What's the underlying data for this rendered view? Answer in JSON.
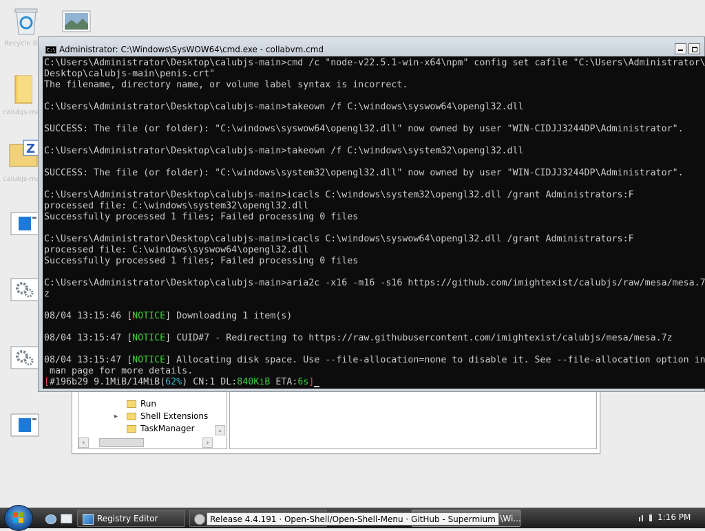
{
  "desktop": {
    "icons": [
      {
        "name": "recycle-bin-icon",
        "label": "Recycle Bin"
      },
      {
        "name": "image-file-icon",
        "label": ""
      },
      {
        "name": "folder-icon",
        "label": "calubjs-main"
      },
      {
        "name": "zip-archive-icon",
        "label": "calubjs-main"
      },
      {
        "name": "window-shortcut-icon",
        "label": ""
      },
      {
        "name": "settings-shortcut-icon",
        "label": ""
      },
      {
        "name": "settings-shortcut-icon-2",
        "label": ""
      },
      {
        "name": "window-shortcut-icon-2",
        "label": ""
      }
    ]
  },
  "registry_editor": {
    "tree_items": [
      "Run",
      "Shell Extensions",
      "TaskManager"
    ]
  },
  "cmd": {
    "title": "Administrator: C:\\Windows\\SysWOW64\\cmd.exe - collabvm.cmd",
    "lines": [
      "C:\\Users\\Administrator\\Desktop\\calubjs-main>cmd /c \"node-v22.5.1-win-x64\\npm\" config set cafile \"C:\\Users\\Administrator\\",
      "Desktop\\calubjs-main\\penis.crt\"",
      "The filename, directory name, or volume label syntax is incorrect.",
      "",
      "C:\\Users\\Administrator\\Desktop\\calubjs-main>takeown /f C:\\windows\\syswow64\\opengl32.dll",
      "",
      "SUCCESS: The file (or folder): \"C:\\windows\\syswow64\\opengl32.dll\" now owned by user \"WIN-CIDJJ3244DP\\Administrator\".",
      "",
      "C:\\Users\\Administrator\\Desktop\\calubjs-main>takeown /f C:\\windows\\system32\\opengl32.dll",
      "",
      "SUCCESS: The file (or folder): \"C:\\windows\\system32\\opengl32.dll\" now owned by user \"WIN-CIDJJ3244DP\\Administrator\".",
      "",
      "C:\\Users\\Administrator\\Desktop\\calubjs-main>icacls C:\\windows\\system32\\opengl32.dll /grant Administrators:F",
      "processed file: C:\\windows\\system32\\opengl32.dll",
      "Successfully processed 1 files; Failed processing 0 files",
      "",
      "C:\\Users\\Administrator\\Desktop\\calubjs-main>icacls C:\\windows\\syswow64\\opengl32.dll /grant Administrators:F",
      "processed file: C:\\windows\\syswow64\\opengl32.dll",
      "Successfully processed 1 files; Failed processing 0 files",
      "",
      "C:\\Users\\Administrator\\Desktop\\calubjs-main>aria2c -x16 -m16 -s16 https://github.com/imightexist/calubjs/raw/mesa/mesa.7",
      "z"
    ],
    "notices": [
      {
        "ts": "08/04 13:15:46",
        "tag": "NOTICE",
        "msg": "Downloading 1 item(s)"
      },
      {
        "ts": "08/04 13:15:47",
        "tag": "NOTICE",
        "msg": "CUID#7 - Redirecting to https://raw.githubusercontent.com/imightexist/calubjs/mesa/mesa.7z"
      },
      {
        "ts": "08/04 13:15:47",
        "tag": "NOTICE",
        "msg": "Allocating disk space. Use --file-allocation=none to disable it. See --file-allocation option in"
      }
    ],
    "notice_continuation": " man page for more details.",
    "progress": {
      "id": "#196b29",
      "size": "9.1MiB/14MiB",
      "percent": "62%",
      "cn": "CN:1",
      "dl_label": "DL:",
      "dl_value": "840KiB",
      "eta_label": "ETA:",
      "eta_value": "6s"
    }
  },
  "taskbar": {
    "items": [
      {
        "label": "Registry Editor"
      },
      {
        "label": "Release 4.4.191 · Open-Shell/Open-Shell-Menu · GitHub - Supermium"
      },
      {
        "label": "Administrator: C:\\Wi..."
      }
    ],
    "tooltip": "Release 4.4.191 · Open-Shell/Open-Shell-Menu · GitHub - Supermium",
    "visible_cmd_label": "rator: C:\\Wi...",
    "clock": "1:16 PM"
  }
}
